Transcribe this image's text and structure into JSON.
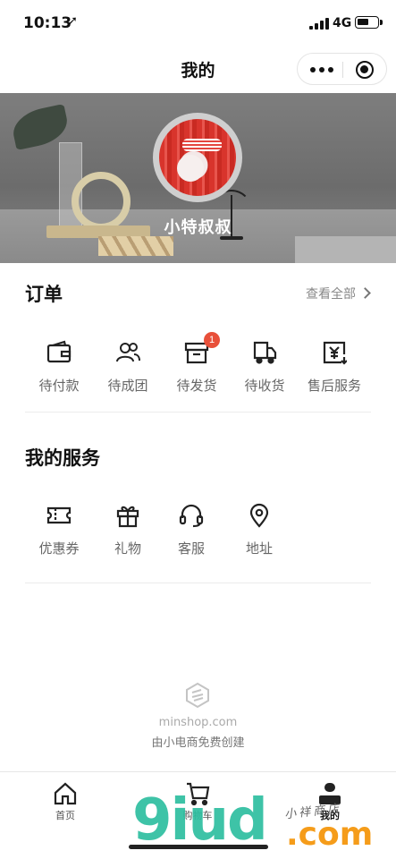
{
  "status_bar": {
    "time": "10:13",
    "network": "4G"
  },
  "nav": {
    "title": "我的"
  },
  "profile": {
    "username": "小特叔叔"
  },
  "orders": {
    "title": "订单",
    "view_all": "查看全部",
    "items": [
      {
        "label": "待付款",
        "icon": "wallet-icon"
      },
      {
        "label": "待成团",
        "icon": "group-icon"
      },
      {
        "label": "待发货",
        "icon": "box-icon",
        "badge": "1"
      },
      {
        "label": "待收货",
        "icon": "truck-icon"
      },
      {
        "label": "售后服务",
        "icon": "refund-icon"
      }
    ]
  },
  "services": {
    "title": "我的服务",
    "items": [
      {
        "label": "优惠券",
        "icon": "coupon-icon"
      },
      {
        "label": "礼物",
        "icon": "gift-icon"
      },
      {
        "label": "客服",
        "icon": "headset-icon"
      },
      {
        "label": "地址",
        "icon": "location-pin-icon"
      }
    ]
  },
  "brand": {
    "domain": "minshop.com",
    "tagline": "由小电商免费创建"
  },
  "tabbar": {
    "items": [
      {
        "label": "首页",
        "icon": "home-icon"
      },
      {
        "label": "购物车",
        "icon": "cart-icon"
      },
      {
        "label": "我的",
        "icon": "person-icon",
        "active": true
      }
    ]
  },
  "watermark": {
    "text": "9iud",
    "suffix": ".com",
    "cn": "小祥商店"
  }
}
